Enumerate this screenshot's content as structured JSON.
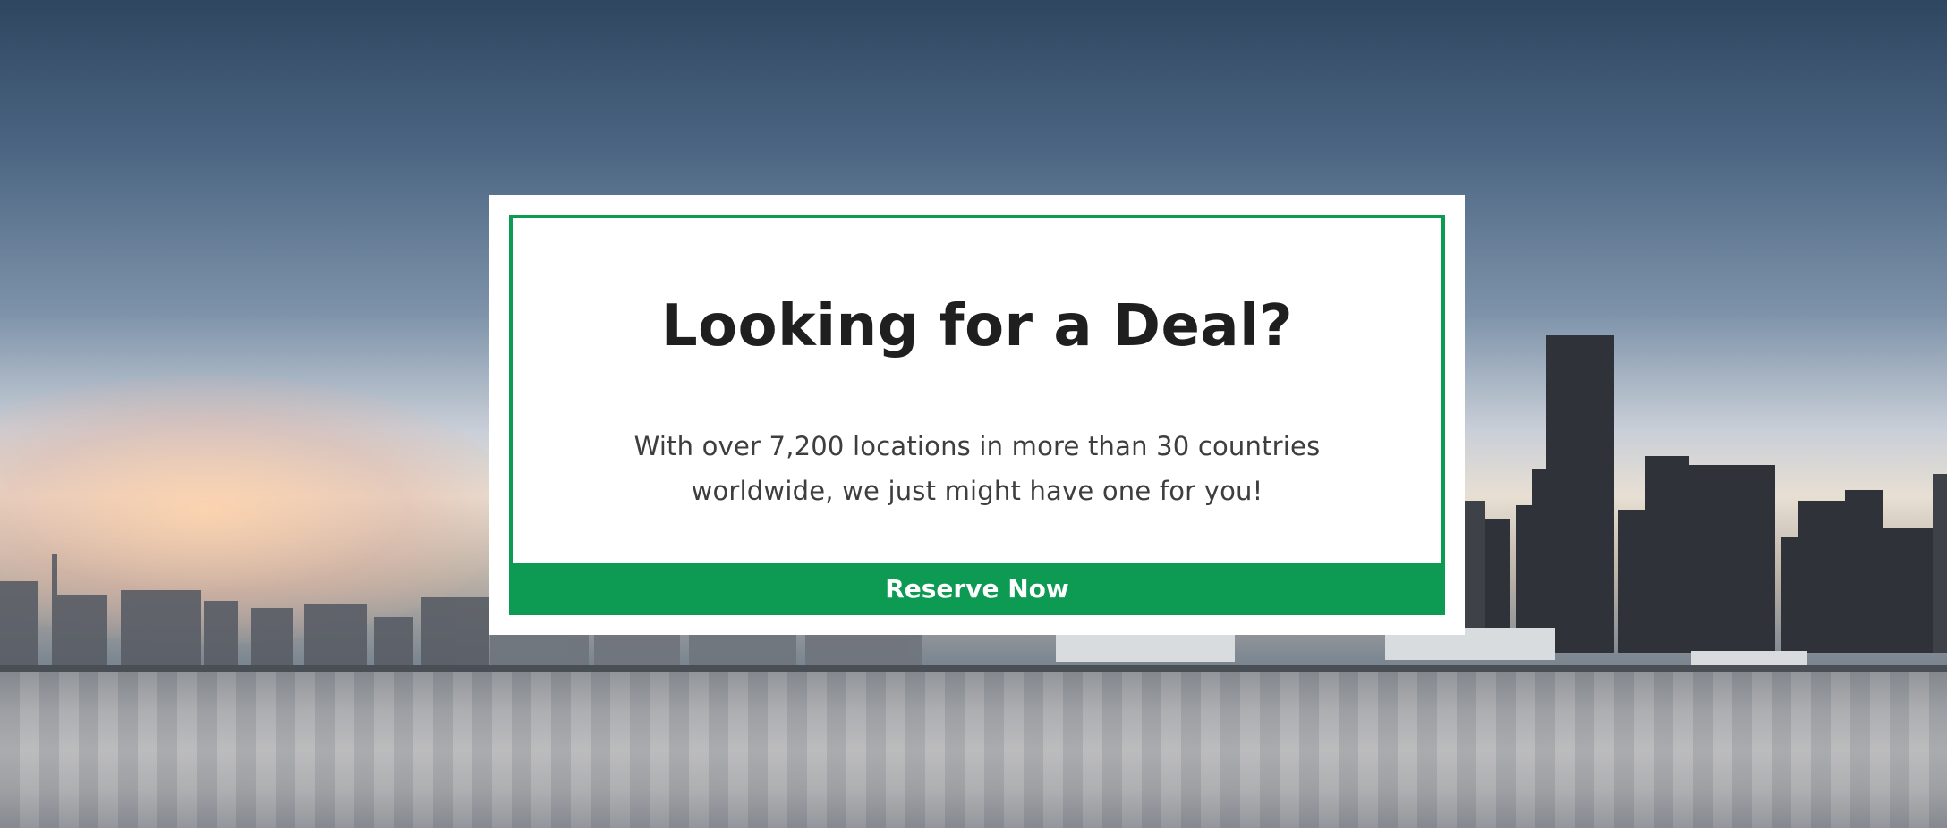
{
  "hero": {
    "background_colors": {
      "sky": "#4b6582",
      "sunset": "#e8dfd3",
      "water": "#a9aaad"
    }
  },
  "promo": {
    "title": "Looking for a Deal?",
    "body_line_1": "With over 7,200 locations in more than 30 countries",
    "body_line_2": "worldwide, we just might have one for you!",
    "button_label": "Reserve Now",
    "accent_color": "#0d9a52"
  }
}
